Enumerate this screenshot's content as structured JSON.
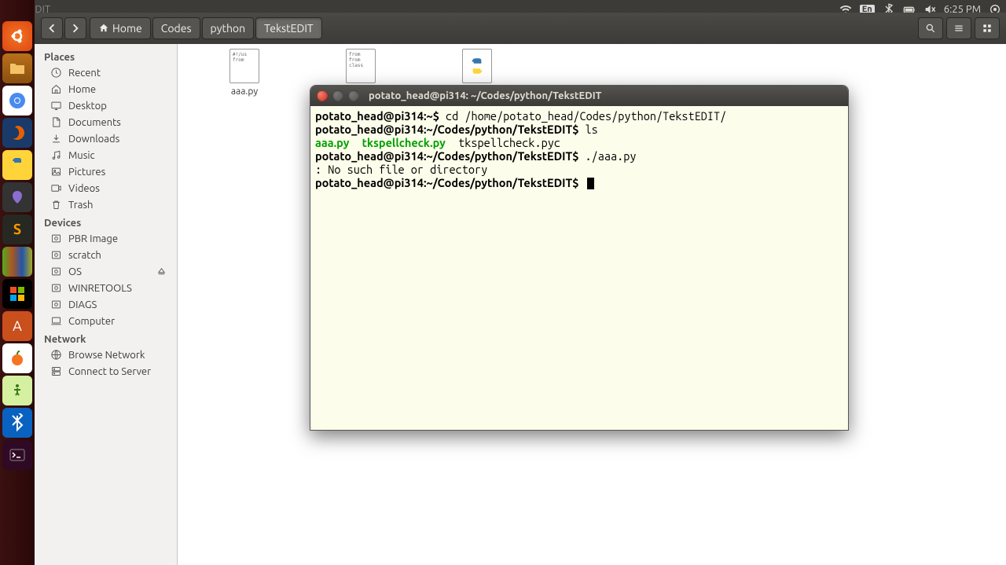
{
  "menubar": {
    "title": "TekstEDIT",
    "lang": "En",
    "time": "6:25 PM"
  },
  "toolbar": {
    "path": [
      "Home",
      "Codes",
      "python",
      "TekstEDIT"
    ]
  },
  "sidebar": {
    "headers": {
      "places": "Places",
      "devices": "Devices",
      "network": "Network"
    },
    "places": [
      {
        "label": "Recent",
        "icon": "clock"
      },
      {
        "label": "Home",
        "icon": "home"
      },
      {
        "label": "Desktop",
        "icon": "desktop"
      },
      {
        "label": "Documents",
        "icon": "doc"
      },
      {
        "label": "Downloads",
        "icon": "download"
      },
      {
        "label": "Music",
        "icon": "music"
      },
      {
        "label": "Pictures",
        "icon": "picture"
      },
      {
        "label": "Videos",
        "icon": "video"
      },
      {
        "label": "Trash",
        "icon": "trash"
      }
    ],
    "devices": [
      {
        "label": "PBR Image",
        "icon": "disk"
      },
      {
        "label": "scratch",
        "icon": "disk"
      },
      {
        "label": "OS",
        "icon": "disk",
        "eject": true
      },
      {
        "label": "WINRETOOLS",
        "icon": "disk"
      },
      {
        "label": "DIAGS",
        "icon": "disk"
      },
      {
        "label": "Computer",
        "icon": "computer"
      }
    ],
    "network": [
      {
        "label": "Browse Network",
        "icon": "network"
      },
      {
        "label": "Connect to Server",
        "icon": "server"
      }
    ]
  },
  "files": [
    {
      "name": "aaa.py",
      "type": "script",
      "preview": "#!/us\n\nfrom"
    },
    {
      "name": "",
      "type": "script",
      "preview": "from\nfrom\n\nclass"
    },
    {
      "name": "",
      "type": "pyc"
    }
  ],
  "terminal": {
    "title": "potato_head@pi314: ~/Codes/python/TekstEDIT",
    "lines": [
      {
        "prompt": "potato_head@pi314:~$",
        "cmd": " cd /home/potato_head/Codes/python/TekstEDIT/"
      },
      {
        "prompt": "potato_head@pi314:~/Codes/python/TekstEDIT$",
        "cmd": " ls"
      },
      {
        "ls": [
          {
            "text": "aaa.py",
            "cls": "green"
          },
          {
            "text": "  "
          },
          {
            "text": "tkspellcheck.py",
            "cls": "green"
          },
          {
            "text": "  tkspellcheck.pyc"
          }
        ]
      },
      {
        "prompt": "potato_head@pi314:~/Codes/python/TekstEDIT$",
        "cmd": " ./aaa.py"
      },
      {
        "text": ": No such file or directory"
      },
      {
        "prompt": "potato_head@pi314:~/Codes/python/TekstEDIT$",
        "cmd": " ",
        "cursor": true
      }
    ]
  }
}
